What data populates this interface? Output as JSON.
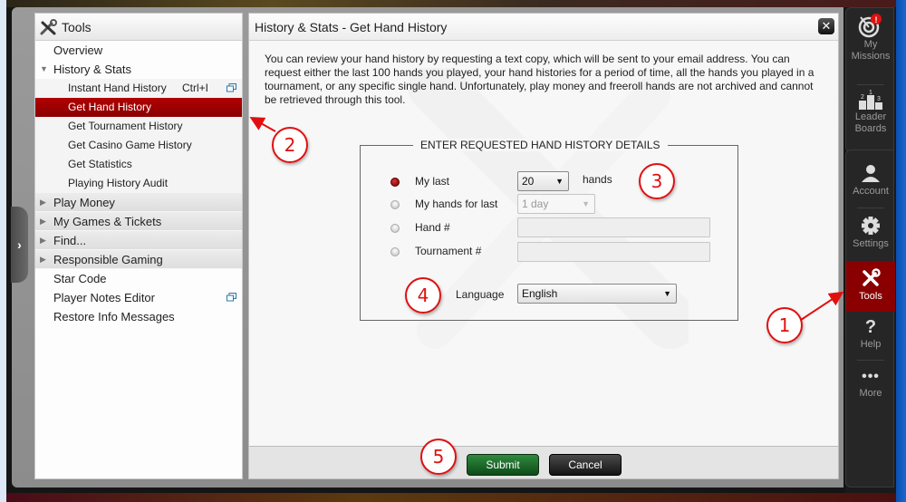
{
  "nav": {
    "title": "Tools",
    "items": [
      {
        "label": "Overview",
        "level": 0
      },
      {
        "label": "History & Stats",
        "level": 0,
        "expanded": true
      },
      {
        "label": "Instant Hand History",
        "shortcut": "Ctrl+I",
        "level": 1,
        "popout": true
      },
      {
        "label": "Get Hand History",
        "level": 1,
        "active": true
      },
      {
        "label": "Get Tournament History",
        "level": 1
      },
      {
        "label": "Get Casino Game History",
        "level": 1
      },
      {
        "label": "Get Statistics",
        "level": 1
      },
      {
        "label": "Playing History Audit",
        "level": 1
      },
      {
        "label": "Play Money",
        "level": 0,
        "collapsed": true
      },
      {
        "label": "My Games & Tickets",
        "level": 0,
        "collapsed": true
      },
      {
        "label": "Find...",
        "level": 0,
        "collapsed": true
      },
      {
        "label": "Responsible Gaming",
        "level": 0,
        "collapsed": true
      },
      {
        "label": "Star Code",
        "level": 0
      },
      {
        "label": "Player Notes Editor",
        "level": 0,
        "popout": true
      },
      {
        "label": "Restore Info Messages",
        "level": 0
      }
    ]
  },
  "main": {
    "title": "History & Stats - Get Hand History",
    "intro": "You can review your hand history by requesting a text copy, which will be sent to your email address. You can request either the last 100 hands you played, your hand histories for a period of time, all the hands you played in a tournament, or any specific single hand. Unfortunately, play money and freeroll hands are not archived and cannot be retrieved through this tool.",
    "form": {
      "legend": "ENTER REQUESTED HAND HISTORY DETAILS",
      "options": [
        {
          "label": "My last",
          "checked": true,
          "control": "select",
          "value": "20",
          "suffix": "hands"
        },
        {
          "label": "My hands for last",
          "checked": false,
          "control": "select-disabled",
          "value": "1 day"
        },
        {
          "label": "Hand #",
          "checked": false,
          "control": "text",
          "value": ""
        },
        {
          "label": "Tournament #",
          "checked": false,
          "control": "text",
          "value": ""
        }
      ],
      "language_label": "Language",
      "language_value": "English"
    },
    "submit_label": "Submit",
    "cancel_label": "Cancel",
    "close_glyph": "✕"
  },
  "sidebar": {
    "items": [
      {
        "label_line1": "My",
        "label_line2": "Missions",
        "icon": "target-icon",
        "badge": "!"
      },
      {
        "label_line1": "Leader",
        "label_line2": "Boards",
        "icon": "podium-icon"
      },
      {
        "label_line1": "Account",
        "icon": "user-icon"
      },
      {
        "label_line1": "Settings",
        "icon": "gear-icon"
      },
      {
        "label_line1": "Tools",
        "icon": "tools-icon",
        "active": true
      },
      {
        "label_line1": "Help",
        "icon": "question-icon"
      },
      {
        "label_line1": "More",
        "icon": "ellipsis-icon"
      }
    ]
  },
  "annotations": [
    "1",
    "2",
    "3",
    "4",
    "5"
  ],
  "colors": {
    "accent_red": "#8a0000",
    "submit_green": "#1e6b2a",
    "annotation_red": "#e01010"
  },
  "collapse_glyph": "›"
}
